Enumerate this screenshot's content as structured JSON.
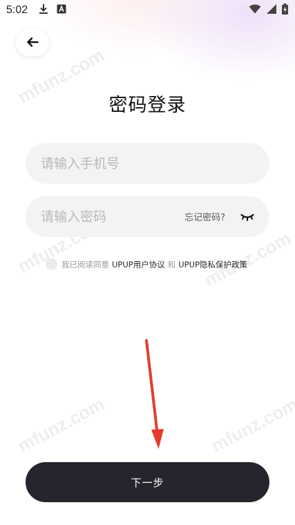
{
  "status_bar": {
    "time": "5:02",
    "left_icons": [
      "download-icon",
      "a-badge-icon"
    ],
    "right_icons": [
      "wifi-icon",
      "signal-icon",
      "battery-icon"
    ]
  },
  "header": {
    "back_icon": "arrow-left-icon"
  },
  "page": {
    "title": "密码登录"
  },
  "form": {
    "phone_placeholder": "请输入手机号",
    "phone_value": "",
    "password_placeholder": "请输入密码",
    "password_value": "",
    "forgot_label": "忘记密码?",
    "eye_icon": "eye-closed-icon"
  },
  "agreement": {
    "prefix": "我已阅读同意",
    "user_agreement": "UPUP用户协议",
    "conjunction": "和",
    "privacy_policy": "UPUP隐私保护政策",
    "checked": false
  },
  "actions": {
    "next_label": "下一步"
  },
  "watermark": {
    "text": "mfunz.com"
  },
  "colors": {
    "primary_button": "#26252d",
    "field_background": "#f3f3f4",
    "annotation_arrow": "#e53b2c"
  }
}
